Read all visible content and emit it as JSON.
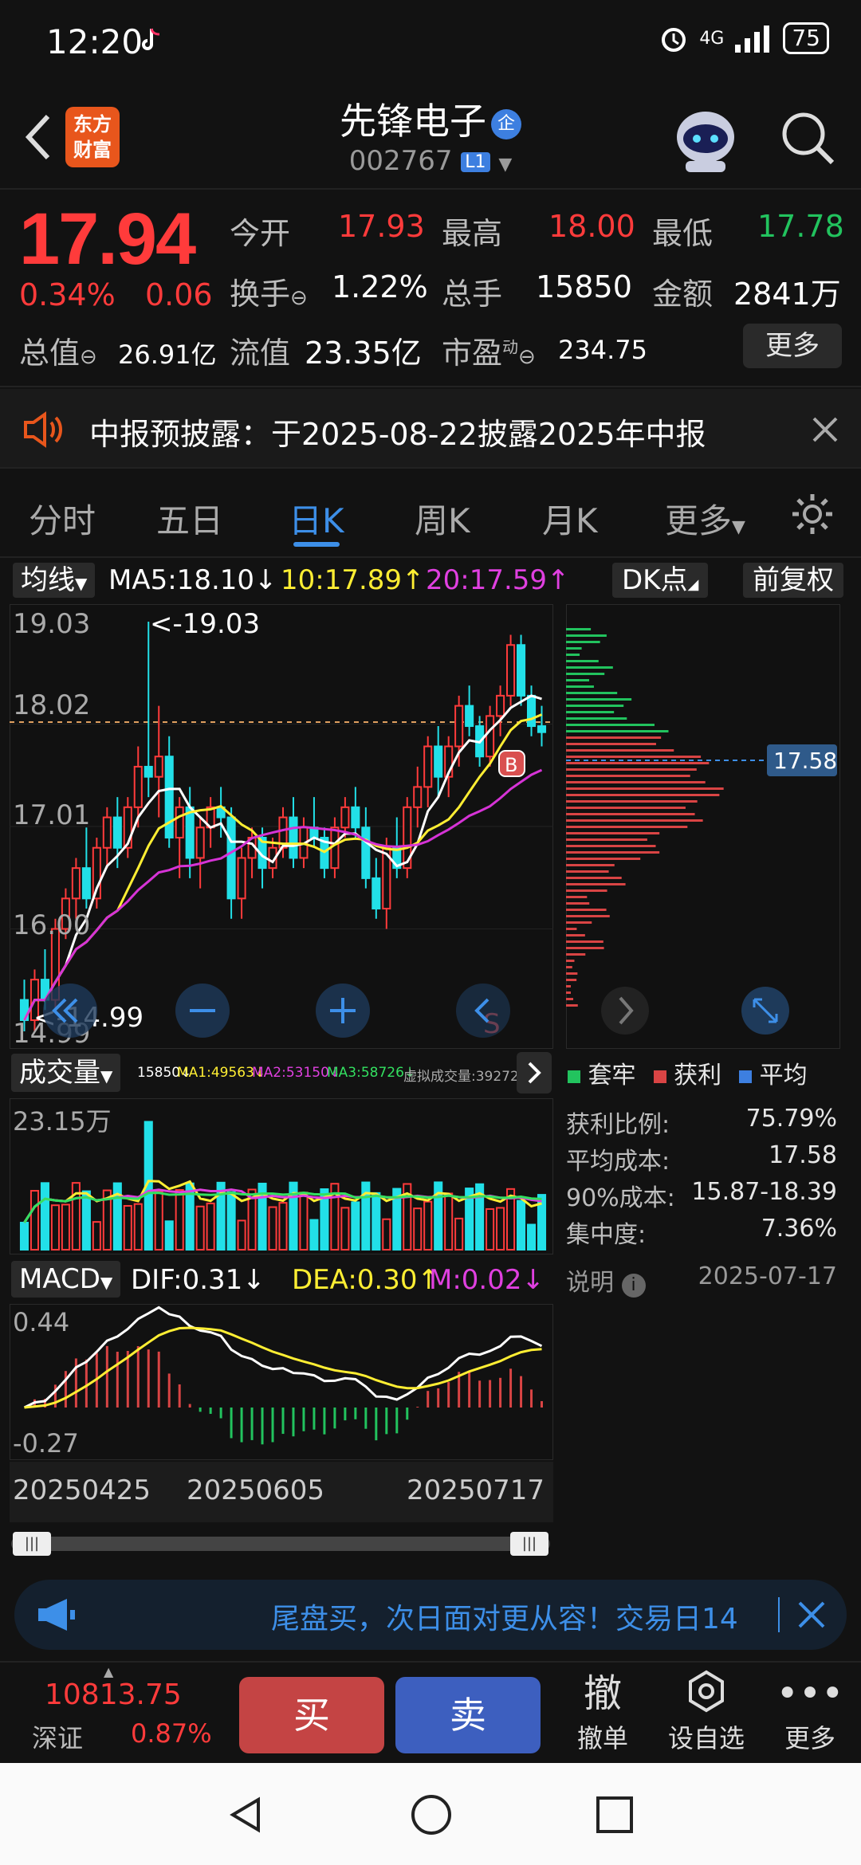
{
  "status": {
    "time": "12:20",
    "network": "4G",
    "battery": "75"
  },
  "header": {
    "logo": "东方财富",
    "name": "先锋电子",
    "name_tag": "企",
    "code": "002767",
    "level": "L1"
  },
  "quote": {
    "price": "17.94",
    "change_pct": "0.34%",
    "change": "0.06",
    "open_label": "今开",
    "open": "17.93",
    "high_label": "最高",
    "high": "18.00",
    "low_label": "最低",
    "low": "17.78",
    "turnover_label": "换手",
    "turnover": "1.22%",
    "volume_label": "总手",
    "volume": "15850",
    "amount_label": "金额",
    "amount": "2841万",
    "mktcap_label": "总值",
    "mktcap": "26.91亿",
    "float_label": "流值",
    "float": "23.35亿",
    "pe_label": "市盈",
    "pe_sup": "动",
    "pe": "234.75",
    "more": "更多"
  },
  "notice": {
    "text": "中报预披露：于2025-08-22披露2025年中报"
  },
  "tabs": [
    "分时",
    "五日",
    "日K",
    "周K",
    "月K",
    "更多"
  ],
  "ma_bar": {
    "selector": "均线",
    "ma5": "MA5:18.10↓",
    "ma10": "10:17.89↑",
    "ma20": "20:17.59↑",
    "dk": "DK点",
    "fq": "前复权"
  },
  "colors": {
    "up": "#ff3b3b",
    "down": "#22e0e8",
    "ma5": "#ffffff",
    "ma10": "#ffee33",
    "ma20": "#d633d6",
    "accent": "#3d8fe8"
  },
  "kchart": {
    "axis_labels": [
      "19.03",
      "18.02",
      "17.01",
      "16.00",
      "14.99"
    ],
    "max_label": "<-19.03",
    "min_label": "<-14.99",
    "b_mark": "B",
    "s_mark": "S"
  },
  "chip": {
    "avg_label": "17.58"
  },
  "volume_bar": {
    "selector": "成交量",
    "vol": "15850↓",
    "ma1": "MA1:49563↓",
    "ma2": "MA2:53150↓",
    "ma3": "MA3:58726↓",
    "virtual": "虚拟成交量:39272",
    "axis_top": "23.15万"
  },
  "macd_bar": {
    "selector": "MACD",
    "dif": "DIF:0.31↓",
    "dea": "DEA:0.30↑",
    "m": "M:0.02↓",
    "axis_top": "0.44",
    "axis_bottom": "-0.27"
  },
  "dates": [
    "20250425",
    "20250605",
    "20250717"
  ],
  "legend": {
    "trapped": "套牢",
    "profit": "获利",
    "avg": "平均"
  },
  "stats": [
    {
      "label": "获利比例:",
      "value": "75.79%"
    },
    {
      "label": "平均成本:",
      "value": "17.58"
    },
    {
      "label": "90%成本:",
      "value": "15.87-18.39"
    },
    {
      "label": "集中度:",
      "value": "7.36%"
    }
  ],
  "explain": {
    "label": "说明",
    "date": "2025-07-17"
  },
  "promo": {
    "text": "尾盘买，次日面对更从容！交易日14"
  },
  "bottom": {
    "index_value": "10813.75",
    "index_name": "深证",
    "index_pct": "0.87%",
    "buy": "买",
    "sell": "卖",
    "cancel_icon": "撤",
    "cancel": "撤单",
    "fav": "设自选",
    "more": "更多"
  },
  "chart_data": {
    "type": "candlestick",
    "y_range": [
      14.99,
      19.03
    ],
    "ohlc": [
      [
        15.3,
        15.5,
        14.99,
        15.1
      ],
      [
        15.1,
        15.6,
        14.99,
        15.5
      ],
      [
        15.5,
        15.8,
        15.2,
        15.3
      ],
      [
        15.3,
        16.1,
        15.2,
        16.0
      ],
      [
        16.0,
        16.4,
        15.9,
        16.3
      ],
      [
        16.3,
        16.7,
        16.1,
        16.6
      ],
      [
        16.6,
        17.0,
        16.2,
        16.3
      ],
      [
        16.3,
        16.9,
        16.2,
        16.8
      ],
      [
        16.8,
        17.2,
        16.6,
        17.1
      ],
      [
        17.1,
        17.3,
        16.6,
        16.8
      ],
      [
        16.8,
        17.3,
        16.7,
        17.2
      ],
      [
        17.2,
        17.8,
        17.0,
        17.6
      ],
      [
        17.6,
        19.03,
        17.3,
        17.5
      ],
      [
        17.5,
        18.2,
        17.1,
        17.7
      ],
      [
        17.7,
        17.9,
        16.8,
        16.9
      ],
      [
        16.9,
        17.3,
        16.5,
        17.2
      ],
      [
        17.2,
        17.4,
        16.5,
        16.7
      ],
      [
        16.7,
        17.1,
        16.4,
        17.0
      ],
      [
        17.0,
        17.3,
        16.8,
        17.2
      ],
      [
        17.2,
        17.4,
        16.9,
        17.1
      ],
      [
        17.1,
        17.2,
        16.1,
        16.3
      ],
      [
        16.3,
        16.8,
        16.1,
        16.7
      ],
      [
        16.7,
        17.0,
        16.5,
        16.9
      ],
      [
        16.9,
        17.0,
        16.4,
        16.6
      ],
      [
        16.6,
        16.9,
        16.5,
        16.8
      ],
      [
        16.8,
        17.2,
        16.7,
        17.1
      ],
      [
        17.1,
        17.3,
        16.6,
        16.7
      ],
      [
        16.7,
        17.1,
        16.6,
        17.0
      ],
      [
        17.0,
        17.3,
        16.8,
        16.9
      ],
      [
        16.9,
        17.0,
        16.5,
        16.6
      ],
      [
        16.6,
        17.1,
        16.5,
        17.0
      ],
      [
        17.0,
        17.3,
        16.9,
        17.2
      ],
      [
        17.2,
        17.4,
        16.9,
        17.0
      ],
      [
        17.0,
        17.2,
        16.4,
        16.5
      ],
      [
        16.5,
        16.7,
        16.1,
        16.2
      ],
      [
        16.2,
        16.9,
        16.0,
        16.8
      ],
      [
        16.8,
        17.1,
        16.5,
        16.6
      ],
      [
        16.6,
        17.3,
        16.5,
        17.2
      ],
      [
        17.2,
        17.6,
        17.0,
        17.4
      ],
      [
        17.4,
        17.9,
        17.2,
        17.8
      ],
      [
        17.8,
        18.0,
        17.3,
        17.5
      ],
      [
        17.5,
        17.9,
        17.3,
        17.8
      ],
      [
        17.8,
        18.3,
        17.6,
        18.2
      ],
      [
        18.2,
        18.4,
        17.9,
        18.0
      ],
      [
        18.0,
        18.1,
        17.6,
        17.7
      ],
      [
        17.7,
        18.2,
        17.6,
        18.1
      ],
      [
        18.1,
        18.4,
        17.9,
        18.3
      ],
      [
        18.3,
        18.9,
        18.2,
        18.8
      ],
      [
        18.8,
        18.9,
        18.2,
        18.3
      ],
      [
        18.3,
        18.4,
        17.9,
        18.0
      ],
      [
        18.0,
        18.2,
        17.8,
        17.94
      ]
    ]
  }
}
